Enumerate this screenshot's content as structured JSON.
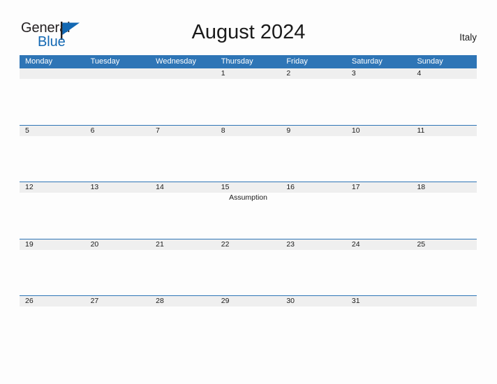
{
  "brand": {
    "word_one": "General",
    "word_two": "Blue",
    "mark_icon": "blue-flag-triangle-icon",
    "dark_color": "#231f20",
    "blue_color": "#1268b3"
  },
  "header": {
    "title": "August 2024",
    "locale": "Italy"
  },
  "theme": {
    "header_bar": "#2e75b6",
    "date_band": "#efefef",
    "page_background": "#fdfdfd",
    "rule_color": "#2e75b6",
    "text_color": "#1a1a1a"
  },
  "calendar": {
    "weekdays": [
      "Monday",
      "Tuesday",
      "Wednesday",
      "Thursday",
      "Friday",
      "Saturday",
      "Sunday"
    ],
    "weeks": [
      {
        "days": [
          {
            "date": "",
            "event": ""
          },
          {
            "date": "",
            "event": ""
          },
          {
            "date": "",
            "event": ""
          },
          {
            "date": "1",
            "event": ""
          },
          {
            "date": "2",
            "event": ""
          },
          {
            "date": "3",
            "event": ""
          },
          {
            "date": "4",
            "event": ""
          }
        ]
      },
      {
        "days": [
          {
            "date": "5",
            "event": ""
          },
          {
            "date": "6",
            "event": ""
          },
          {
            "date": "7",
            "event": ""
          },
          {
            "date": "8",
            "event": ""
          },
          {
            "date": "9",
            "event": ""
          },
          {
            "date": "10",
            "event": ""
          },
          {
            "date": "11",
            "event": ""
          }
        ]
      },
      {
        "days": [
          {
            "date": "12",
            "event": ""
          },
          {
            "date": "13",
            "event": ""
          },
          {
            "date": "14",
            "event": ""
          },
          {
            "date": "15",
            "event": "Assumption"
          },
          {
            "date": "16",
            "event": ""
          },
          {
            "date": "17",
            "event": ""
          },
          {
            "date": "18",
            "event": ""
          }
        ]
      },
      {
        "days": [
          {
            "date": "19",
            "event": ""
          },
          {
            "date": "20",
            "event": ""
          },
          {
            "date": "21",
            "event": ""
          },
          {
            "date": "22",
            "event": ""
          },
          {
            "date": "23",
            "event": ""
          },
          {
            "date": "24",
            "event": ""
          },
          {
            "date": "25",
            "event": ""
          }
        ]
      },
      {
        "days": [
          {
            "date": "26",
            "event": ""
          },
          {
            "date": "27",
            "event": ""
          },
          {
            "date": "28",
            "event": ""
          },
          {
            "date": "29",
            "event": ""
          },
          {
            "date": "30",
            "event": ""
          },
          {
            "date": "31",
            "event": ""
          },
          {
            "date": "",
            "event": ""
          }
        ]
      }
    ]
  }
}
